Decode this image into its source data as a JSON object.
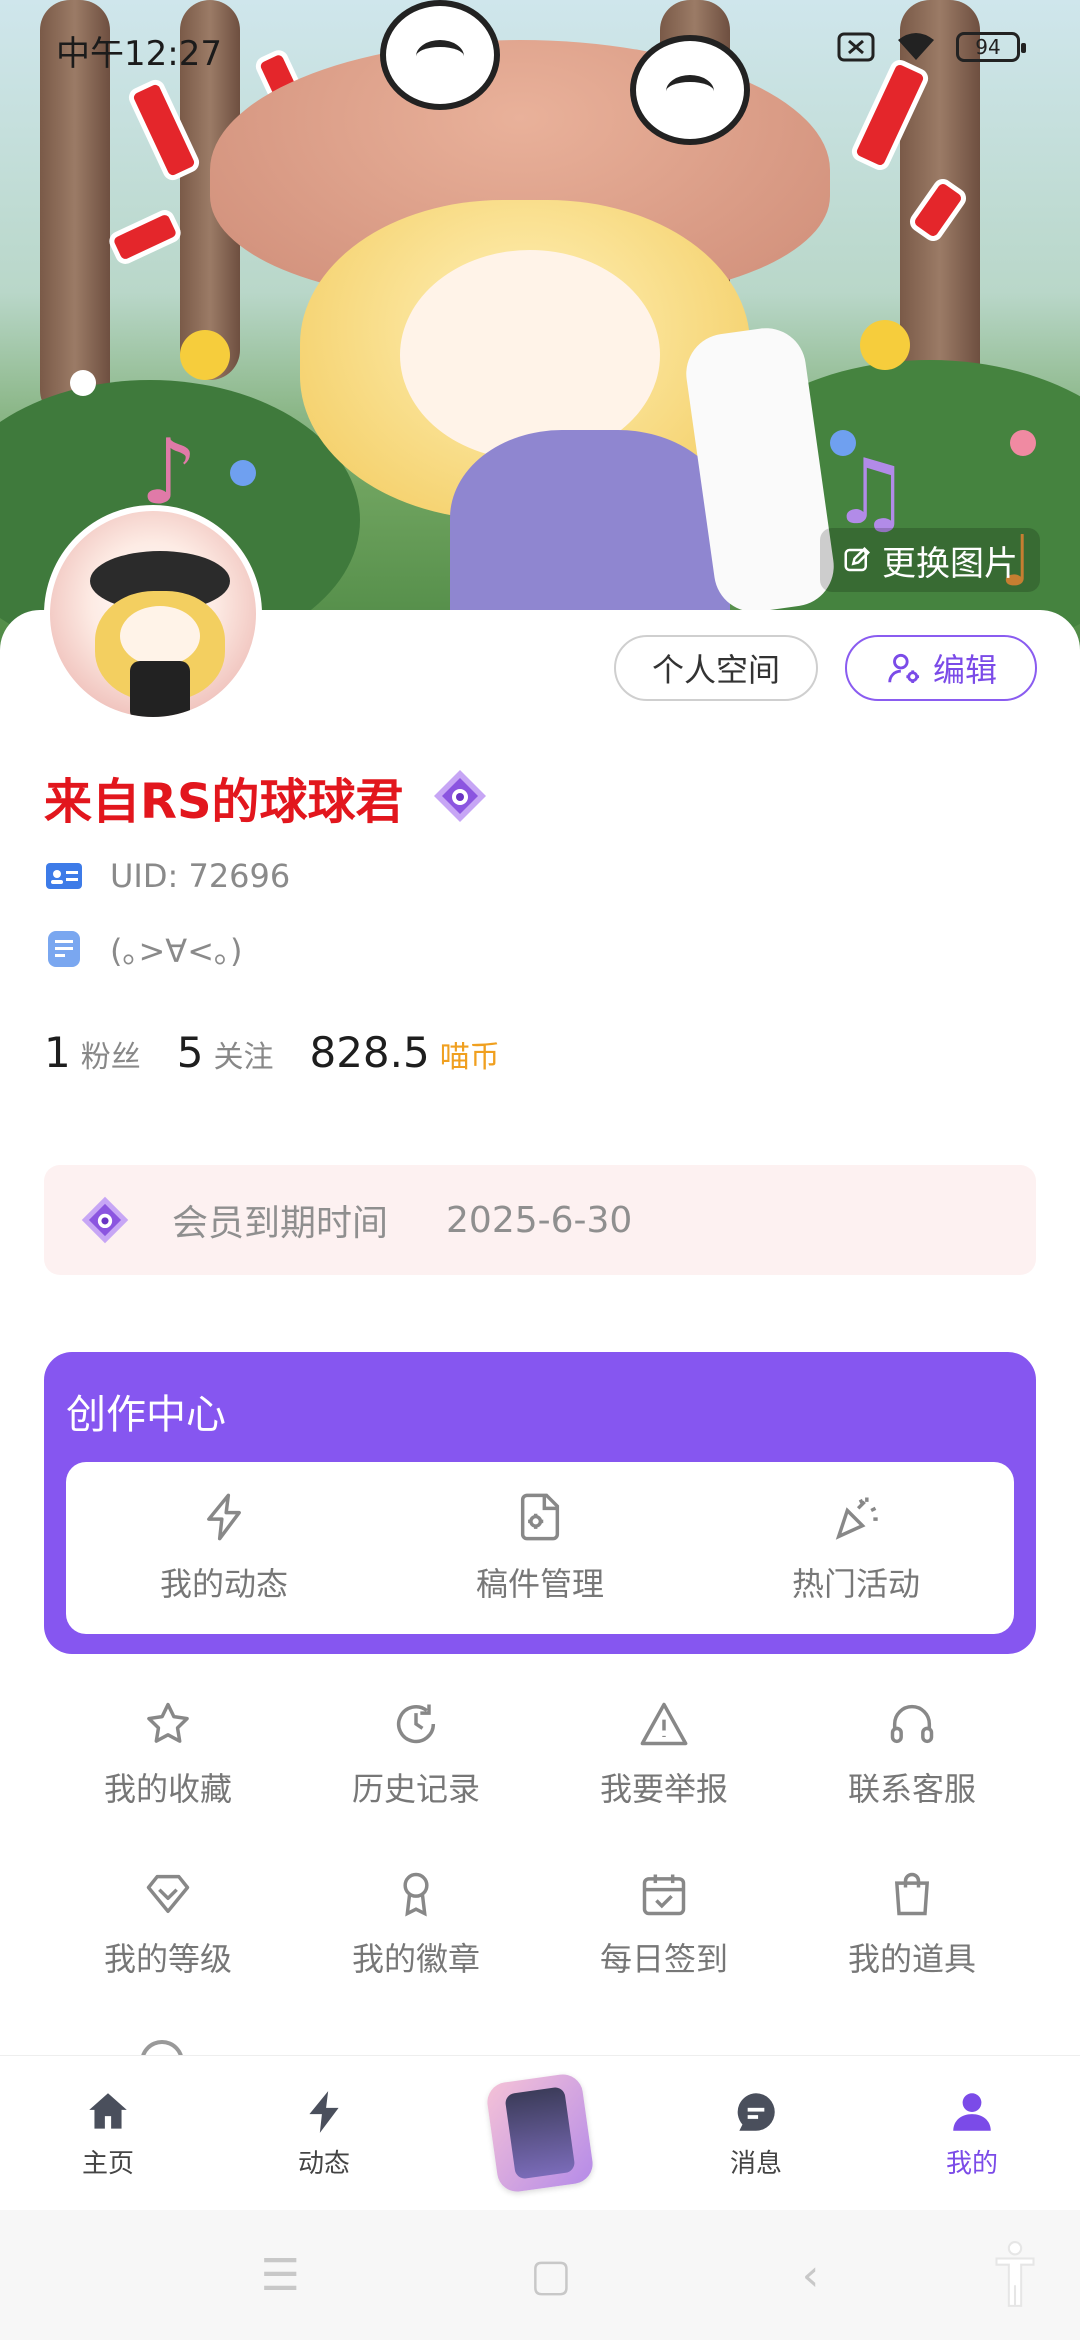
{
  "status_bar": {
    "time": "中午12:27",
    "battery": "94"
  },
  "banner": {
    "change_photo_label": "更换图片"
  },
  "profile": {
    "space_button": "个人空间",
    "edit_button": "编辑",
    "username": "来自RS的球球君",
    "uid": "UID: 72696",
    "signature": "(｡>∀<｡)",
    "username_color": "#e2161d"
  },
  "stats": {
    "followers_count": "1",
    "followers_label": "粉丝",
    "following_count": "5",
    "following_label": "关注",
    "coins_count": "828.5",
    "coins_label": "喵币"
  },
  "membership": {
    "label": "会员到期时间",
    "expiry": "2025-6-30"
  },
  "creator_center": {
    "title": "创作中心",
    "items": [
      {
        "label": "我的动态",
        "icon": "lightning-icon"
      },
      {
        "label": "稿件管理",
        "icon": "file-gear-icon"
      },
      {
        "label": "热门活动",
        "icon": "party-popper-icon"
      }
    ]
  },
  "menu": {
    "row1": [
      {
        "label": "我的收藏",
        "icon": "star-icon"
      },
      {
        "label": "历史记录",
        "icon": "history-clock-icon"
      },
      {
        "label": "我要举报",
        "icon": "warning-icon"
      },
      {
        "label": "联系客服",
        "icon": "headset-icon"
      }
    ],
    "row2": [
      {
        "label": "我的等级",
        "icon": "level-diamond-icon"
      },
      {
        "label": "我的徽章",
        "icon": "badge-ribbon-icon"
      },
      {
        "label": "每日签到",
        "icon": "calendar-check-icon"
      },
      {
        "label": "我的道具",
        "icon": "shopping-bag-icon"
      }
    ]
  },
  "bottom_nav": {
    "items": [
      {
        "label": "主页",
        "icon": "home-icon"
      },
      {
        "label": "动态",
        "icon": "lightning-icon"
      },
      {
        "label": "",
        "icon": "center-card-icon"
      },
      {
        "label": "消息",
        "icon": "chat-icon"
      },
      {
        "label": "我的",
        "icon": "user-icon"
      }
    ],
    "active_color": "#7b4be8"
  },
  "theme": {
    "accent": "#8656f0",
    "coin_color": "#f0a020",
    "vip_bar_bg": "#fdf1f1"
  }
}
